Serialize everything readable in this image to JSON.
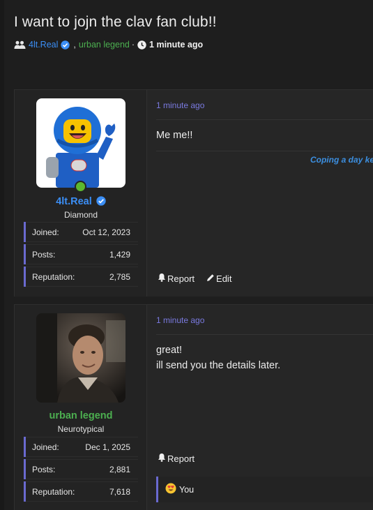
{
  "thread": {
    "title": "I want to jojn the clav fan club!!",
    "participants": [
      {
        "name": "4lt.Real",
        "verified": true,
        "color": "#3b8ef5"
      },
      {
        "name": "urban legend",
        "color": "#4caf50"
      }
    ],
    "comma": ",",
    "separator": "·",
    "time": "1 minute ago"
  },
  "posts": [
    {
      "user": {
        "name": "4lt.Real",
        "name_color": "#3b8ef5",
        "verified": true,
        "online": true,
        "title": "Diamond",
        "avatar": "lego-astronaut-avatar",
        "stats": [
          {
            "label": "Joined:",
            "value": "Oct 12, 2023"
          },
          {
            "label": "Posts:",
            "value": "1,429"
          },
          {
            "label": "Reputation:",
            "value": "2,785"
          }
        ]
      },
      "time": "1 minute ago",
      "text": "Me me!!",
      "signature": "Coping a day ke",
      "actions": {
        "report": "Report",
        "edit": "Edit"
      }
    },
    {
      "user": {
        "name": "urban legend",
        "name_color": "#4caf50",
        "title": "Neurotypical",
        "avatar": "man-photo-avatar",
        "stats": [
          {
            "label": "Joined:",
            "value": "Dec 1, 2025"
          },
          {
            "label": "Posts:",
            "value": "2,881"
          },
          {
            "label": "Reputation:",
            "value": "7,618"
          }
        ]
      },
      "time": "1 minute ago",
      "text_lines": [
        "great!",
        "ill send you the details later."
      ],
      "actions": {
        "report": "Report"
      },
      "reaction": {
        "icon": "heart-eyes-emoji-icon",
        "label": "You"
      }
    }
  ],
  "colors": {
    "accent_border": "#6a6ad0",
    "time_link": "#7a7ae0",
    "online": "#5cb82e"
  }
}
